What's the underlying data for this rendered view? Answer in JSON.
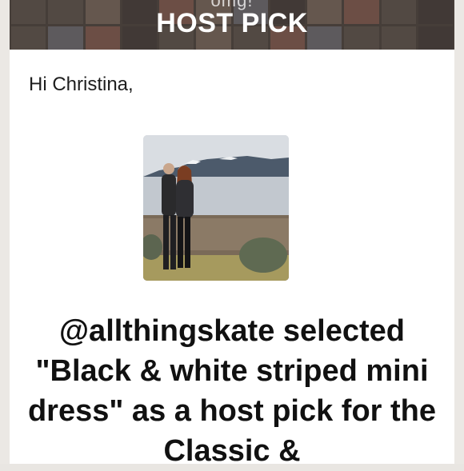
{
  "banner": {
    "subtitle": "omg!",
    "title": "HOST PICK"
  },
  "email": {
    "greeting": "Hi Christina,",
    "headline": "@allthingskate selected \"Black & white striped mini dress\" as a host pick for the Classic &"
  },
  "colors": {
    "card_bg": "#ffffff",
    "banner_overlay": "#3a2f2c",
    "headline_text": "#111111"
  }
}
